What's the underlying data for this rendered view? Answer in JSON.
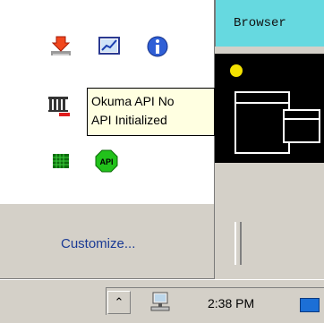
{
  "app": {
    "title": "Browser"
  },
  "tray_popup": {
    "icons": [
      {
        "name": "download-tray-icon"
      },
      {
        "name": "monitor-graph-icon"
      },
      {
        "name": "info-icon"
      },
      {
        "name": "device-controller-icon"
      },
      {
        "name": "green-grid-icon"
      },
      {
        "name": "api-status-icon",
        "label": "API"
      }
    ],
    "customize_label": "Customize..."
  },
  "tooltip": {
    "line1": "Okuma API No",
    "line2": "API Initialized"
  },
  "taskbar": {
    "chevron": "⌃",
    "clock": "2:38 PM"
  },
  "colors": {
    "browser_tab_bg": "#66d9e0",
    "link_blue": "#1a3a94",
    "tooltip_bg": "#ffffe1",
    "api_green": "#22c21b"
  }
}
